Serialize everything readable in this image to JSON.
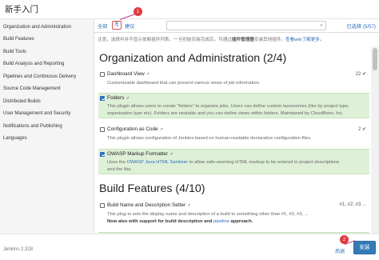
{
  "window": {
    "title": "新手入门"
  },
  "sidebar": {
    "categories": [
      "Organization and Administration",
      "Build Features",
      "Build Tools",
      "Build Analysis and Reporting",
      "Pipelines and Continuous Delivery",
      "Source Code Management",
      "Distributed Builds",
      "User Management and Security",
      "Notifications and Publishing",
      "Languages"
    ]
  },
  "toolbar": {
    "all_label": "全部",
    "none_label": "无",
    "suggested_label": "建议",
    "search_placeholder": "",
    "clear_label": "×",
    "selected_label": "已选择 (5/57)"
  },
  "notice": {
    "prefix": "注意，",
    "text_1": "选择中并不显示依赖插件列表。",
    "text_2": "一旦初始安装完成后，可通过",
    "manager": "插件管理器",
    "text_3": "安装其他插件。",
    "wiki": "查看wiki了解更多。"
  },
  "sections": [
    {
      "title": "Organization and Administration (2/4)"
    },
    {
      "title": "Build Features (4/10)"
    }
  ],
  "plugins": [
    {
      "name": "Dashboard View",
      "ext": "↗",
      "stats": "22 ✔",
      "checked": false,
      "desc": "Customizable dashboard that can present various views of job information."
    },
    {
      "name": "Folders",
      "ext": "↗",
      "stats": "",
      "checked": true,
      "desc_1": "This plugin allows users to create \"folders\" to organize jobs. Users can define custom taxonomies (like by project type,",
      "desc_2": "organization type etc). Folders are nestable and you can define views within folders. Maintained by CloudBees, Inc."
    },
    {
      "name": "Configuration as Code",
      "ext": "↗",
      "stats": "2 ✔",
      "checked": false,
      "desc": "This plugin allows configuration of Jenkins based on human-readable declarative configuration files."
    },
    {
      "name": "OWASP Markup Formatter",
      "ext": "↗",
      "stats": "",
      "checked": true,
      "desc_prefix": "Uses the ",
      "desc_link": "OWASP Java HTML Sanitizer",
      "desc_suffix": " to allow safe-seeming HTML markup to be entered in project descriptions",
      "desc_2": "and the like."
    },
    {
      "name": "Build Name and Description Setter",
      "ext": "↗",
      "stats": "#1, #2, #3 ...",
      "checked": false,
      "desc_1": "This plug-in sets the display name and description of a build to something other than #1, #2, #3, ...",
      "desc_2_prefix": "Now also with support for build description and ",
      "desc_2_link": "pipeline",
      "desc_2_suffix": " approach."
    }
  ],
  "footer": {
    "version": "Jenkins 2.328",
    "back_label": "后退",
    "install_label": "安装"
  },
  "markers": [
    "1",
    "2"
  ],
  "colors": {
    "link": "#2a6ebb",
    "checked_row": "#dff0d8",
    "primary_button": "#337ab7",
    "marker": "#e0393e"
  }
}
